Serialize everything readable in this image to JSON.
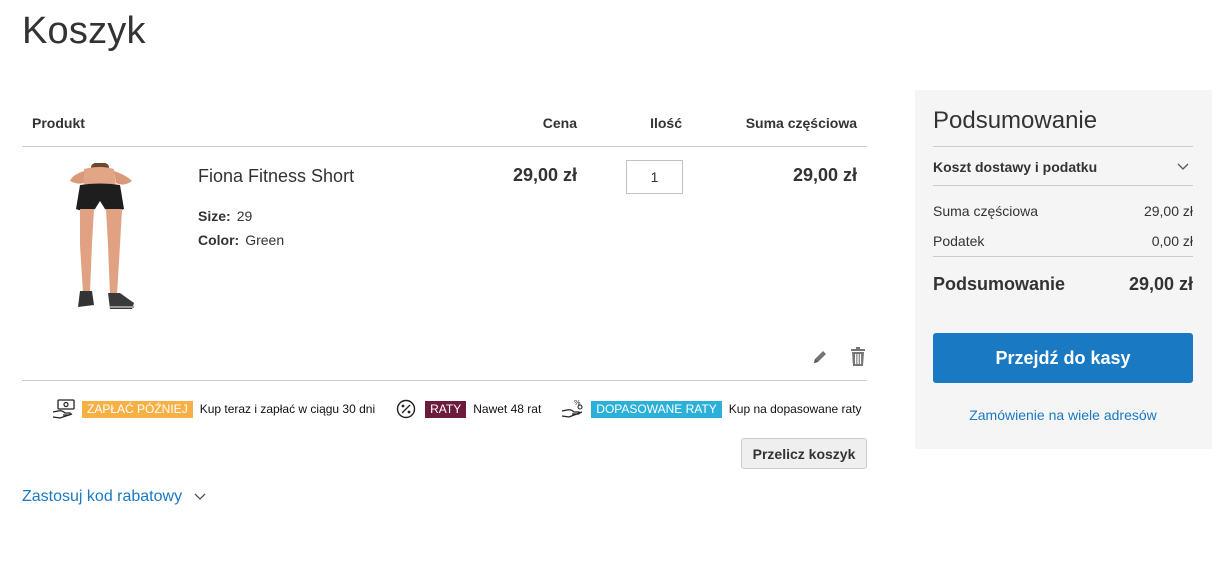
{
  "page": {
    "title": "Koszyk"
  },
  "cart": {
    "headers": {
      "product": "Produkt",
      "price": "Cena",
      "qty": "Ilość",
      "subtotal": "Suma częściowa"
    },
    "items": [
      {
        "name": "Fiona Fitness Short",
        "options": [
          {
            "label": "Size:",
            "value": "29"
          },
          {
            "label": "Color:",
            "value": "Green"
          }
        ],
        "price": "29,00 zł",
        "qty": "1",
        "subtotal": "29,00 zł"
      }
    ],
    "update_button": "Przelicz koszyk",
    "discount_link": "Zastosuj kod rabatowy"
  },
  "banner": {
    "later_badge": "ZAPŁAĆ PÓŹNIEJ",
    "later_text": "Kup teraz i zapłać w ciągu 30 dni",
    "raty_badge": "RATY",
    "raty_text": "Nawet 48 rat",
    "fit_badge": "DOPASOWANE RATY",
    "fit_text": "Kup na dopasowane raty"
  },
  "summary": {
    "title": "Podsumowanie",
    "shipping_label": "Koszt dostawy i podatku",
    "subtotal_label": "Suma częściowa",
    "subtotal_value": "29,00 zł",
    "tax_label": "Podatek",
    "tax_value": "0,00 zł",
    "total_label": "Podsumowanie",
    "total_value": "29,00 zł",
    "checkout_button": "Przejdź do kasy",
    "multi_address_link": "Zamówienie na wiele adresów"
  },
  "colors": {
    "accent": "#1979c3",
    "later": "#f7b043",
    "raty": "#6d1a3f",
    "fit": "#2bb1d9"
  },
  "icons": [
    "edit-icon",
    "trash-icon",
    "chevron-down-icon",
    "money-hand-icon",
    "percent-icon",
    "hand-coins-icon"
  ]
}
